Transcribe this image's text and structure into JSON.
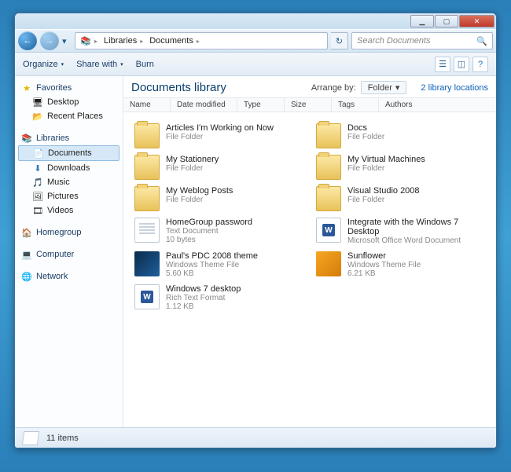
{
  "titlebar": {
    "min": "▁",
    "max": "▢",
    "close": "✕"
  },
  "nav": {
    "back": "←",
    "forward": "→",
    "history_dd": "▾",
    "refresh": "↻",
    "breadcrumbs": [
      {
        "icon": "📚",
        "label": ""
      },
      {
        "label": "Libraries"
      },
      {
        "label": "Documents"
      }
    ],
    "search_placeholder": "Search Documents",
    "search_icon": "🔍"
  },
  "toolbar": {
    "organize": "Organize",
    "share": "Share with",
    "burn": "Burn",
    "dd": "▾"
  },
  "sidebar": {
    "favorites": {
      "label": "Favorites",
      "icon": "★",
      "items": [
        {
          "label": "Desktop",
          "icon": "🖥"
        },
        {
          "label": "Recent Places",
          "icon": "📂"
        }
      ]
    },
    "libraries": {
      "label": "Libraries",
      "icon": "📚",
      "items": [
        {
          "label": "Documents",
          "icon": "📄",
          "selected": true
        },
        {
          "label": "Downloads",
          "icon": "⬇"
        },
        {
          "label": "Music",
          "icon": "🎵"
        },
        {
          "label": "Pictures",
          "icon": "🖼"
        },
        {
          "label": "Videos",
          "icon": "🎞"
        }
      ]
    },
    "homegroup": {
      "label": "Homegroup",
      "icon": "🏠"
    },
    "computer": {
      "label": "Computer",
      "icon": "💻"
    },
    "network": {
      "label": "Network",
      "icon": "🌐"
    }
  },
  "header": {
    "title": "Documents library",
    "arrange_label": "Arrange by:",
    "arrange_value": "Folder",
    "dd": "▾",
    "locations": "2 library locations"
  },
  "columns": [
    "Name",
    "Date modified",
    "Type",
    "Size",
    "Tags",
    "Authors"
  ],
  "items": [
    {
      "name": "Articles I'm Working on Now",
      "sub1": "File Folder",
      "sub2": "",
      "kind": "folder"
    },
    {
      "name": "Docs",
      "sub1": "File Folder",
      "sub2": "",
      "kind": "folder"
    },
    {
      "name": "My Stationery",
      "sub1": "File Folder",
      "sub2": "",
      "kind": "folder"
    },
    {
      "name": "My Virtual Machines",
      "sub1": "File Folder",
      "sub2": "",
      "kind": "folder"
    },
    {
      "name": "My Weblog Posts",
      "sub1": "File Folder",
      "sub2": "",
      "kind": "folder"
    },
    {
      "name": "Visual Studio 2008",
      "sub1": "File Folder",
      "sub2": "",
      "kind": "folder"
    },
    {
      "name": "HomeGroup password",
      "sub1": "Text Document",
      "sub2": "10 bytes",
      "kind": "doc"
    },
    {
      "name": "Integrate with the Windows 7 Desktop",
      "sub1": "Microsoft Office Word Document",
      "sub2": "",
      "kind": "word"
    },
    {
      "name": "Paul's PDC 2008 theme",
      "sub1": "Windows Theme File",
      "sub2": "5.60 KB",
      "kind": "theme-dark"
    },
    {
      "name": "Sunflower",
      "sub1": "Windows Theme File",
      "sub2": "6.21 KB",
      "kind": "theme-sun"
    },
    {
      "name": "Windows 7 desktop",
      "sub1": "Rich Text Format",
      "sub2": "1.12 KB",
      "kind": "word"
    }
  ],
  "status": {
    "count": "11 items"
  }
}
